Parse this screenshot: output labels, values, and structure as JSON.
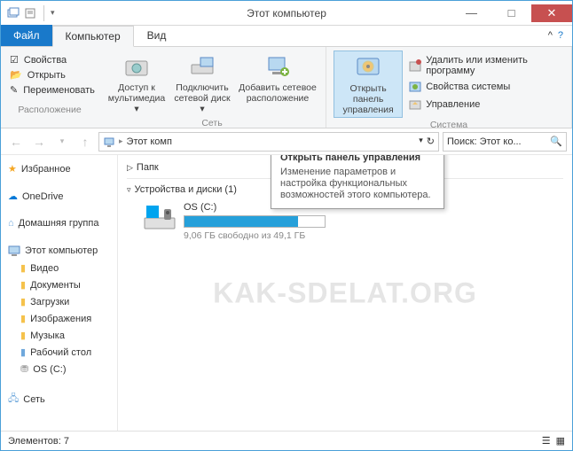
{
  "title": "Этот компьютер",
  "qat": {
    "dropdown": "▾"
  },
  "winbtns": {
    "min": "—",
    "max": "□",
    "close": "✕"
  },
  "tabs": {
    "file": "Файл",
    "computer": "Компьютер",
    "view": "Вид",
    "help": "?",
    "collapse": "^"
  },
  "ribbon_left": {
    "props": "Свойства",
    "open": "Открыть",
    "rename": "Переименовать",
    "group": "Расположение"
  },
  "ribbon": {
    "media": "Доступ к\nмультимедиа ▾",
    "netdrive": "Подключить\nсетевой диск ▾",
    "addnet": "Добавить сетевое\nрасположение",
    "net_group": "Сеть",
    "cpanel": "Открыть панель\nуправления",
    "uninstall": "Удалить или изменить программу",
    "sysprops": "Свойства системы",
    "manage": "Управление",
    "sys_group": "Система"
  },
  "nav": {
    "crumb": "Этот комп",
    "refresh": "↻"
  },
  "search": {
    "placeholder": "Поиск: Этот ко..."
  },
  "tooltip": {
    "title": "Открыть панель управления",
    "body": "Изменение параметров и настройка функциональных возможностей этого компьютера."
  },
  "sidebar": {
    "fav": "Избранное",
    "onedrive": "OneDrive",
    "homegroup": "Домашняя группа",
    "thispc": "Этот компьютер",
    "video": "Видео",
    "docs": "Документы",
    "downloads": "Загрузки",
    "pics": "Изображения",
    "music": "Музыка",
    "desktop": "Рабочий стол",
    "osc": "OS (C:)",
    "network": "Сеть"
  },
  "content": {
    "folders_hdr": "Папк",
    "drives_hdr": "Устройства и диски (1)",
    "drive_name": "OS (C:)",
    "drive_free": "9,06 ГБ свободно из 49,1 ГБ",
    "drive_fill_pct": 81
  },
  "status": {
    "items": "Элементов: 7"
  },
  "watermark": "KAK-SDELAT.ORG"
}
